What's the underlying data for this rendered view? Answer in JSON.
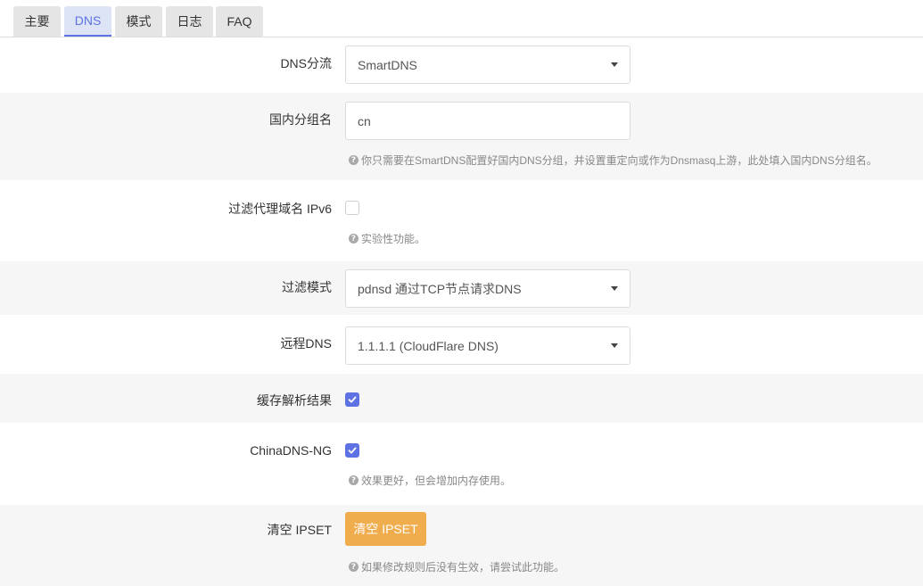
{
  "tabs": [
    "主要",
    "DNS",
    "模式",
    "日志",
    "FAQ"
  ],
  "active_tab": "DNS",
  "form": {
    "dns_split": {
      "label": "DNS分流",
      "value": "SmartDNS"
    },
    "domestic_group": {
      "label": "国内分组名",
      "value": "cn",
      "help": "你只需要在SmartDNS配置好国内DNS分组，并设置重定向或作为Dnsmasq上游，此处填入国内DNS分组名。"
    },
    "filter_ipv6": {
      "label": "过滤代理域名 IPv6",
      "checked": false,
      "help": "实验性功能。"
    },
    "filter_mode": {
      "label": "过滤模式",
      "value": "pdnsd 通过TCP节点请求DNS"
    },
    "remote_dns": {
      "label": "远程DNS",
      "value": "1.1.1.1 (CloudFlare DNS)"
    },
    "cache_results": {
      "label": "缓存解析结果",
      "checked": true
    },
    "chinadns_ng": {
      "label": "ChinaDNS-NG",
      "checked": true,
      "help": "效果更好，但会增加内存使用。"
    },
    "clear_ipset": {
      "label": "清空 IPSET",
      "button": "清空 IPSET",
      "help": "如果修改规则后没有生效，请尝试此功能。"
    }
  },
  "colors": {
    "accent": "#5e72e4",
    "warning": "#f0ad4e"
  },
  "icons": {
    "help": "question-circle-icon",
    "dropdown": "caret-down-icon",
    "check": "check-icon"
  }
}
